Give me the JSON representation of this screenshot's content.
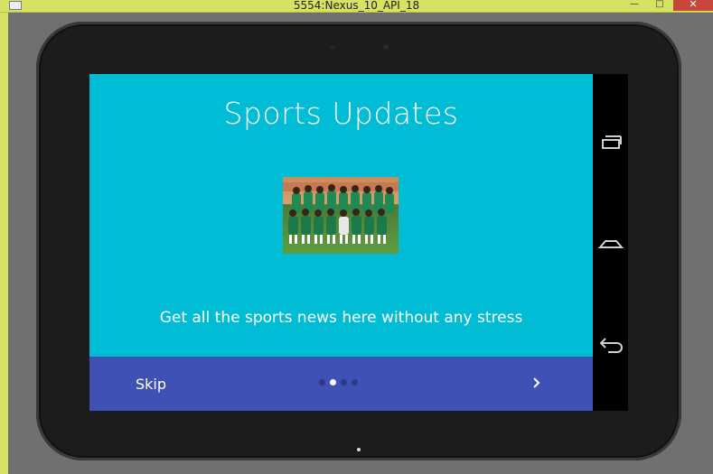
{
  "window": {
    "title": "5554:Nexus_10_API_18",
    "controls": {
      "minimize": "—",
      "maximize": "□",
      "close": "✕"
    }
  },
  "screen": {
    "heading": "Sports Updates",
    "image_alt": "team-photo",
    "tagline": "Get all the sports news here without any stress",
    "background_color": "#00bcd4"
  },
  "bottom_bar": {
    "skip_label": "Skip",
    "pager": {
      "total": 4,
      "active_index": 1
    },
    "next_icon": "chevron-right-icon",
    "background_color": "#3f51b5"
  },
  "nav_bar": {
    "buttons": [
      "recents-icon",
      "home-icon",
      "back-icon"
    ]
  }
}
